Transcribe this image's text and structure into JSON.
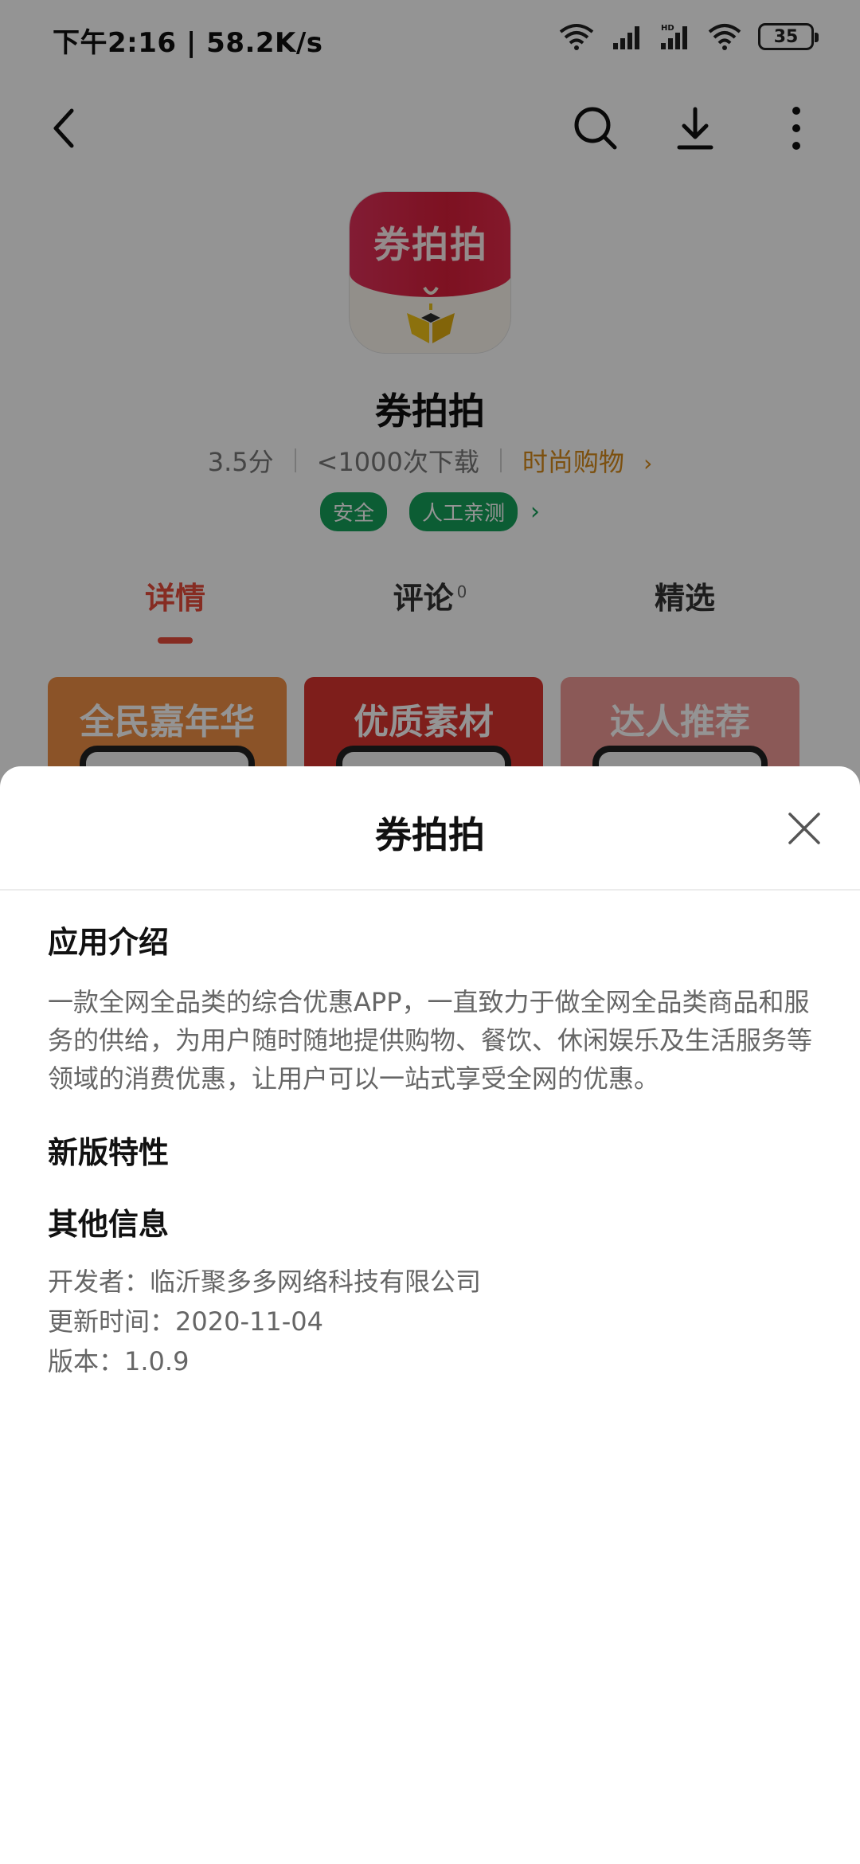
{
  "status_bar": {
    "time": "下午2:16 | 58.2K/s",
    "battery": "35",
    "icons": [
      "wifi-link-icon",
      "signal-icon",
      "hd-signal-icon",
      "wifi-icon",
      "battery-icon"
    ]
  },
  "top_bar": {
    "icons": [
      "back-arrow-icon",
      "search-icon",
      "download-icon",
      "more-vertical-icon"
    ]
  },
  "app": {
    "icon_text": "券拍拍",
    "name": "券拍拍",
    "rating": "3.5分",
    "downloads": "<1000次下载",
    "category": "时尚购物",
    "badges": [
      "安全",
      "人工亲测"
    ]
  },
  "tabs": [
    {
      "label": "详情",
      "active": true
    },
    {
      "label": "评论",
      "count": "0",
      "active": false
    },
    {
      "label": "精选",
      "active": false
    }
  ],
  "screenshots": [
    {
      "title": "全民嘉年华",
      "color": "#ef8f46"
    },
    {
      "title": "优质素材",
      "color": "#d9342f"
    },
    {
      "title": "达人推荐",
      "color": "#ef9a96"
    }
  ],
  "sheet": {
    "title": "券拍拍",
    "intro_heading": "应用介绍",
    "intro_text": "一款全网全品类的综合优惠APP，一直致力于做全网全品类商品和服务的供给，为用户随时随地提供购物、餐饮、休闲娱乐及生活服务等领域的消费优惠，让用户可以一站式享受全网的优惠。",
    "new_features_heading": "新版特性",
    "other_info_heading": "其他信息",
    "developer": "开发者：临沂聚多多网络科技有限公司",
    "update_time": "更新时间：2020-11-04",
    "version": "版本：1.0.9"
  },
  "colors": {
    "accent": "#e74c3c",
    "category": "#d68a1a",
    "badge": "#16a05a",
    "overlay": "rgba(0,0,0,0.42)"
  }
}
